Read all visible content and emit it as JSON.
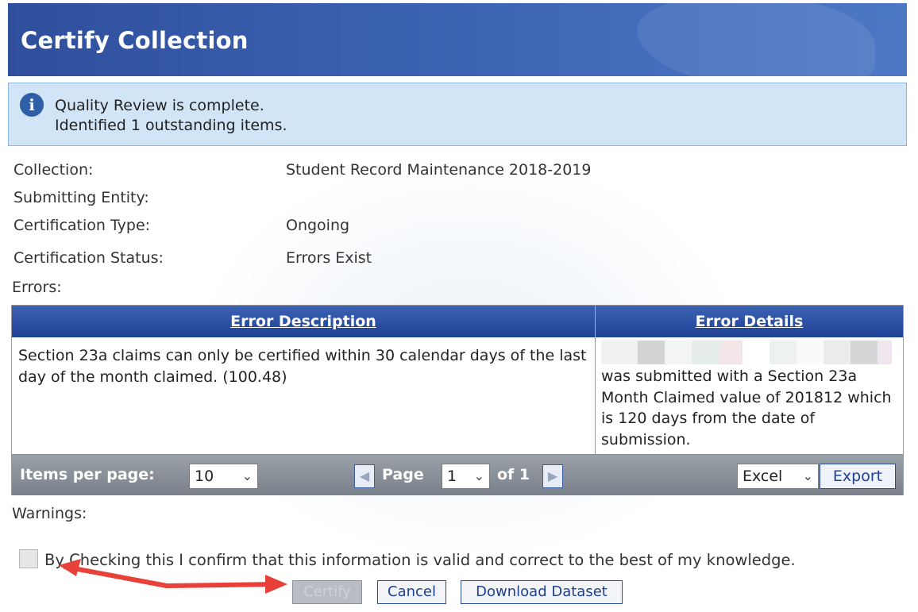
{
  "header": {
    "title": "Certify Collection"
  },
  "info": {
    "icon": "info-icon",
    "line1": "Quality Review is complete.",
    "line2": "Identified 1 outstanding items."
  },
  "fields": [
    {
      "label": "Collection:",
      "value": "Student Record Maintenance 2018-2019"
    },
    {
      "label": "Submitting Entity:",
      "value": ""
    },
    {
      "label": "Certification Type:",
      "value": "Ongoing"
    },
    {
      "label": "Certification Status:",
      "value": "Errors Exist"
    }
  ],
  "errors": {
    "label": "Errors:",
    "columns": [
      "Error Description",
      "Error Details"
    ],
    "rows": [
      {
        "description": "Section 23a claims can only be certified within 30 calendar days of the last day of the month claimed. (100.48)",
        "details": "was submitted with a Section 23a Month Claimed value of 201812 which is 120 days from the date of submission."
      }
    ],
    "pager": {
      "items_per_page_label": "Items per page:",
      "items_per_page_value": "10",
      "page_label": "Page",
      "page_value": "1",
      "of_label": "of 1",
      "export_format": "Excel",
      "export_label": "Export"
    }
  },
  "warnings": {
    "label": "Warnings:"
  },
  "confirm": {
    "text": "By Checking this I confirm that this information is valid and correct to the best of my knowledge."
  },
  "actions": {
    "certify": "Certify",
    "cancel": "Cancel",
    "download": "Download Dataset"
  },
  "colors": {
    "header": "#2f4f9c",
    "info_bg": "#d2e5f7",
    "grid_head": "#1f4196",
    "pager_bg": "#858b94",
    "annotation_arrow": "#e8413a"
  }
}
